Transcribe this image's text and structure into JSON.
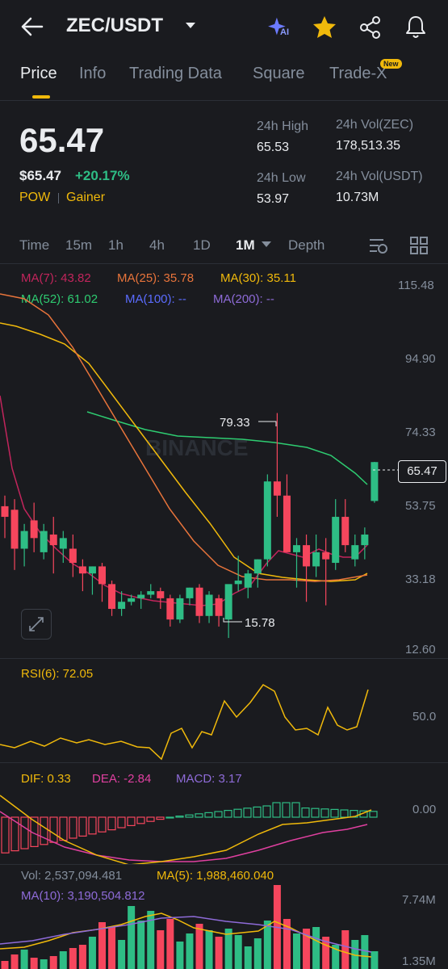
{
  "header": {
    "pair": "ZEC/USDT",
    "ai_badge": "AI",
    "icons": [
      "back-arrow-icon",
      "caret-down-icon",
      "ai-sparkle-icon",
      "star-icon",
      "share-icon",
      "bell-icon"
    ]
  },
  "tabs": [
    {
      "label": "Price",
      "active": true
    },
    {
      "label": "Info"
    },
    {
      "label": "Trading Data"
    },
    {
      "label": "Square"
    },
    {
      "label": "Trade-X",
      "badge": "New"
    }
  ],
  "summary": {
    "last_price": "65.47",
    "usd_price": "$65.47",
    "change": "+20.17%",
    "tag1": "POW",
    "tag2": "Gainer",
    "high_label": "24h High",
    "high_value": "65.53",
    "low_label": "24h Low",
    "low_value": "53.97",
    "vol_base_label": "24h Vol(ZEC)",
    "vol_base_value": "178,513.35",
    "vol_quote_label": "24h Vol(USDT)",
    "vol_quote_value": "10.73M"
  },
  "timeframes": [
    "Time",
    "15m",
    "1h",
    "4h",
    "1D",
    "1M",
    "Depth"
  ],
  "selected_timeframe": "1M",
  "ma": {
    "ma7": "MA(7): 43.82",
    "ma25": "MA(25): 35.78",
    "ma30": "MA(30): 35.11",
    "ma52": "MA(52): 61.02",
    "ma100": "MA(100): --",
    "ma200": "MA(200): --"
  },
  "axis": {
    "price_ticks": [
      "115.48",
      "94.90",
      "74.33",
      "53.75",
      "33.18",
      "12.60"
    ],
    "rsi_tick": "50.0",
    "macd_tick": "0.00",
    "vol_ticks": [
      "7.74M",
      "1.35M"
    ]
  },
  "chart_marks": {
    "high_mark": "79.33",
    "low_mark": "15.78",
    "current_price": "65.47",
    "watermark": "BINANCE"
  },
  "rsi": {
    "label": "RSI(6): 72.05"
  },
  "macd": {
    "dif": "DIF: 0.33",
    "dea": "DEA: -2.84",
    "macd": "MACD: 3.17"
  },
  "volume": {
    "vol": "Vol: 2,537,094.481",
    "ma5": "MA(5): 1,988,460.040",
    "ma10": "MA(10): 3,190,504.812"
  },
  "colors": {
    "up": "#2ebd85",
    "down": "#f6465d",
    "accent": "#f0b90b",
    "ma7": "#c2255c",
    "ma25": "#e8743b",
    "ma30": "#f0b90b",
    "ma52": "#2ecc71",
    "ma100": "#5b6cff",
    "ma200": "#8e6bd8"
  },
  "chart_data": {
    "type": "candlestick",
    "y_axis_price": [
      12.6,
      115.48
    ],
    "candles": [
      {
        "o": 53,
        "h": 56,
        "l": 44,
        "c": 50
      },
      {
        "o": 52,
        "h": 55,
        "l": 35,
        "c": 41
      },
      {
        "o": 41,
        "h": 48,
        "l": 36,
        "c": 46
      },
      {
        "o": 49,
        "h": 54,
        "l": 40,
        "c": 44
      },
      {
        "o": 40,
        "h": 48,
        "l": 38,
        "c": 46
      },
      {
        "o": 45,
        "h": 50,
        "l": 34,
        "c": 42
      },
      {
        "o": 41,
        "h": 46,
        "l": 37,
        "c": 44
      },
      {
        "o": 41,
        "h": 45,
        "l": 33,
        "c": 37
      },
      {
        "o": 36,
        "h": 38,
        "l": 29,
        "c": 34
      },
      {
        "o": 34,
        "h": 36,
        "l": 28,
        "c": 36
      },
      {
        "o": 36,
        "h": 37,
        "l": 26,
        "c": 31
      },
      {
        "o": 31,
        "h": 32,
        "l": 22,
        "c": 24
      },
      {
        "o": 24,
        "h": 29,
        "l": 22,
        "c": 26
      },
      {
        "o": 26,
        "h": 28,
        "l": 25,
        "c": 27
      },
      {
        "o": 27,
        "h": 29,
        "l": 24,
        "c": 28
      },
      {
        "o": 28,
        "h": 31,
        "l": 27,
        "c": 29
      },
      {
        "o": 29,
        "h": 30,
        "l": 24,
        "c": 27
      },
      {
        "o": 27,
        "h": 28,
        "l": 19,
        "c": 21
      },
      {
        "o": 21,
        "h": 28,
        "l": 20,
        "c": 27
      },
      {
        "o": 27,
        "h": 30,
        "l": 25,
        "c": 30
      },
      {
        "o": 30,
        "h": 31,
        "l": 20,
        "c": 22
      },
      {
        "o": 22,
        "h": 29,
        "l": 20,
        "c": 28
      },
      {
        "o": 27,
        "h": 28,
        "l": 19,
        "c": 22
      },
      {
        "o": 21,
        "h": 24,
        "l": 15.78,
        "c": 31
      },
      {
        "o": 31,
        "h": 39,
        "l": 29,
        "c": 32
      },
      {
        "o": 30,
        "h": 35,
        "l": 27,
        "c": 34
      },
      {
        "o": 34,
        "h": 38,
        "l": 30,
        "c": 38
      },
      {
        "o": 38,
        "h": 62,
        "l": 36,
        "c": 60
      },
      {
        "o": 60,
        "h": 79.33,
        "l": 50,
        "c": 56
      },
      {
        "o": 56,
        "h": 62,
        "l": 40,
        "c": 40
      },
      {
        "o": 40,
        "h": 44,
        "l": 30,
        "c": 42
      },
      {
        "o": 42,
        "h": 45,
        "l": 26,
        "c": 36
      },
      {
        "o": 36,
        "h": 45,
        "l": 33,
        "c": 40
      },
      {
        "o": 40,
        "h": 44,
        "l": 25,
        "c": 38
      },
      {
        "o": 37,
        "h": 55,
        "l": 35,
        "c": 50
      },
      {
        "o": 50,
        "h": 55,
        "l": 40,
        "c": 42
      },
      {
        "o": 38,
        "h": 45,
        "l": 36,
        "c": 42
      },
      {
        "o": 42,
        "h": 47,
        "l": 38,
        "c": 45
      },
      {
        "o": 54.48,
        "h": 65.53,
        "l": 53.97,
        "c": 65.47
      }
    ]
  }
}
